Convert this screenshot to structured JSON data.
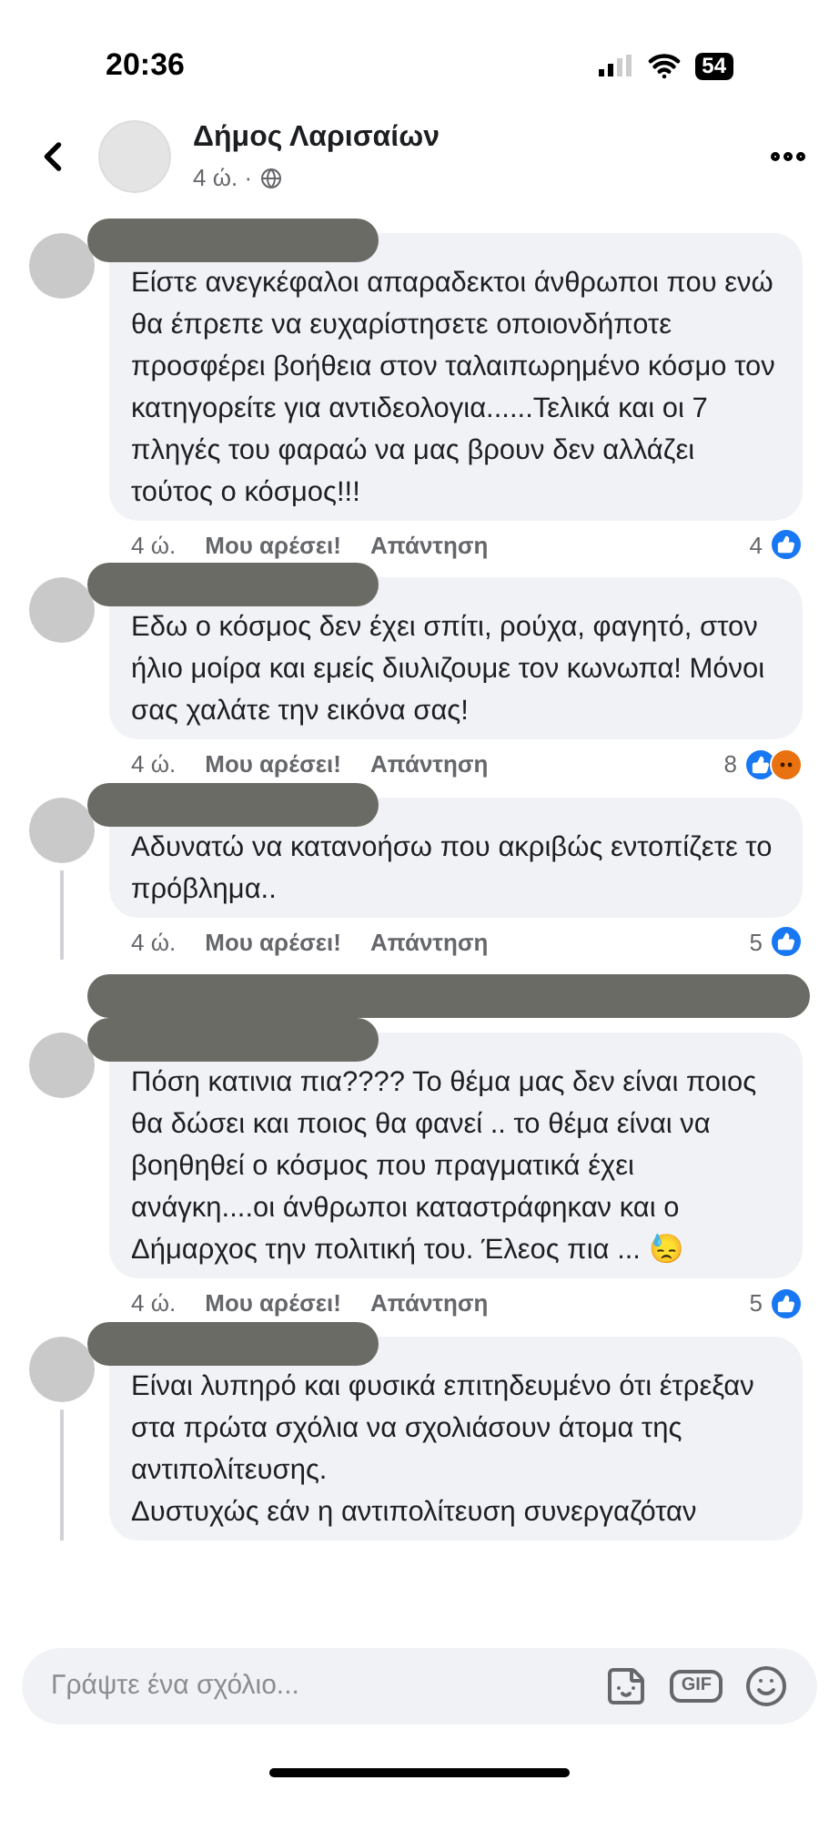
{
  "status_bar": {
    "time": "20:36",
    "battery": "54"
  },
  "post_header": {
    "page_name": "Δήμος Λαρισαίων",
    "meta": "4 ώ. ·"
  },
  "comments": [
    {
      "text": "Είστε ανεγκέφαλοι απαραδεκτοι άνθρωποι που ενώ θα έπρεπε να ευχαρίστησετε οποιονδήποτε προσφέρει βοήθεια στον ταλαιπωρημένο κόσμο τον κατηγορείτε για αντιδεολογια......Τελικά και οι 7 πληγές του φαραώ να μας βρουν δεν αλλάζει τούτος ο κόσμος!!!",
      "thread_line": false,
      "footer": {
        "time": "4 ώ.",
        "like": "Μου αρέσει!",
        "reply": "Απάντηση",
        "count": "4",
        "reactions": [
          {
            "kind": "like"
          }
        ]
      }
    },
    {
      "text": "Εδω ο κόσμος δεν έχει σπίτι, ρούχα, φαγητό, στον ήλιο μοίρα και εμείς διυλιζουμε τον κωνωπα! Μόνοι σας χαλάτε την εικόνα σας!",
      "thread_line": false,
      "footer": {
        "time": "4 ώ.",
        "like": "Μου αρέσει!",
        "reply": "Απάντηση",
        "count": "8",
        "reactions": [
          {
            "kind": "like"
          },
          {
            "kind": "angry"
          }
        ]
      }
    },
    {
      "text": "Αδυνατώ να κατανοήσω που ακριβώς εντοπίζετε το πρόβλημα..",
      "thread_line": true,
      "footer": {
        "time": "4 ώ.",
        "like": "Μου αρέσει!",
        "reply": "Απάντηση",
        "count": "5",
        "reactions": [
          {
            "kind": "like"
          }
        ]
      }
    },
    {
      "text": "Πόση κατινια πια???? Το θέμα μας δεν είναι ποιος θα δώσει και ποιος θα φανεί  .. το θέμα είναι να βοηθηθεί ο κόσμος που πραγματικά έχει ανάγκη....οι άνθρωποι καταστράφηκαν και ο Δήμαρχος την πολιτική του.   Έλεος πια ... 😓",
      "thread_line": false,
      "footer": {
        "time": "4 ώ.",
        "like": "Μου αρέσει!",
        "reply": "Απάντηση",
        "count": "5",
        "reactions": [
          {
            "kind": "like"
          }
        ]
      }
    },
    {
      "text": "Είναι λυπηρό και φυσικά επιτηδευμένο ότι έτρεξαν στα πρώτα σχόλια να σχολιάσουν άτομα της αντιπολίτευσης.\nΔυστυχώς εάν η αντιπολίτευση συνεργαζόταν",
      "thread_line": true
    }
  ],
  "composer": {
    "placeholder": "Γράψτε ένα σχόλιο...",
    "gif_label": "GIF"
  }
}
